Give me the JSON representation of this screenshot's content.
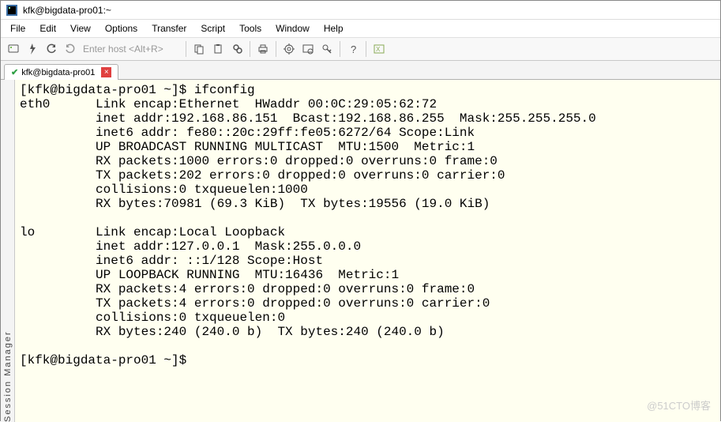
{
  "window": {
    "title": "kfk@bigdata-pro01:~"
  },
  "menu": {
    "file": "File",
    "edit": "Edit",
    "view": "View",
    "options": "Options",
    "transfer": "Transfer",
    "script": "Script",
    "tools": "Tools",
    "window": "Window",
    "help": "Help"
  },
  "toolbar": {
    "host_placeholder": "Enter host <Alt+R>"
  },
  "tabs": {
    "active": {
      "label": "kfk@bigdata-pro01"
    }
  },
  "sidebar": {
    "label": "Session Manager"
  },
  "terminal": {
    "content": "[kfk@bigdata-pro01 ~]$ ifconfig\neth0      Link encap:Ethernet  HWaddr 00:0C:29:05:62:72\n          inet addr:192.168.86.151  Bcast:192.168.86.255  Mask:255.255.255.0\n          inet6 addr: fe80::20c:29ff:fe05:6272/64 Scope:Link\n          UP BROADCAST RUNNING MULTICAST  MTU:1500  Metric:1\n          RX packets:1000 errors:0 dropped:0 overruns:0 frame:0\n          TX packets:202 errors:0 dropped:0 overruns:0 carrier:0\n          collisions:0 txqueuelen:1000\n          RX bytes:70981 (69.3 KiB)  TX bytes:19556 (19.0 KiB)\n\nlo        Link encap:Local Loopback\n          inet addr:127.0.0.1  Mask:255.0.0.0\n          inet6 addr: ::1/128 Scope:Host\n          UP LOOPBACK RUNNING  MTU:16436  Metric:1\n          RX packets:4 errors:0 dropped:0 overruns:0 frame:0\n          TX packets:4 errors:0 dropped:0 overruns:0 carrier:0\n          collisions:0 txqueuelen:0\n          RX bytes:240 (240.0 b)  TX bytes:240 (240.0 b)\n\n[kfk@bigdata-pro01 ~]$ "
  },
  "watermark": {
    "text": "@51CTO博客"
  }
}
